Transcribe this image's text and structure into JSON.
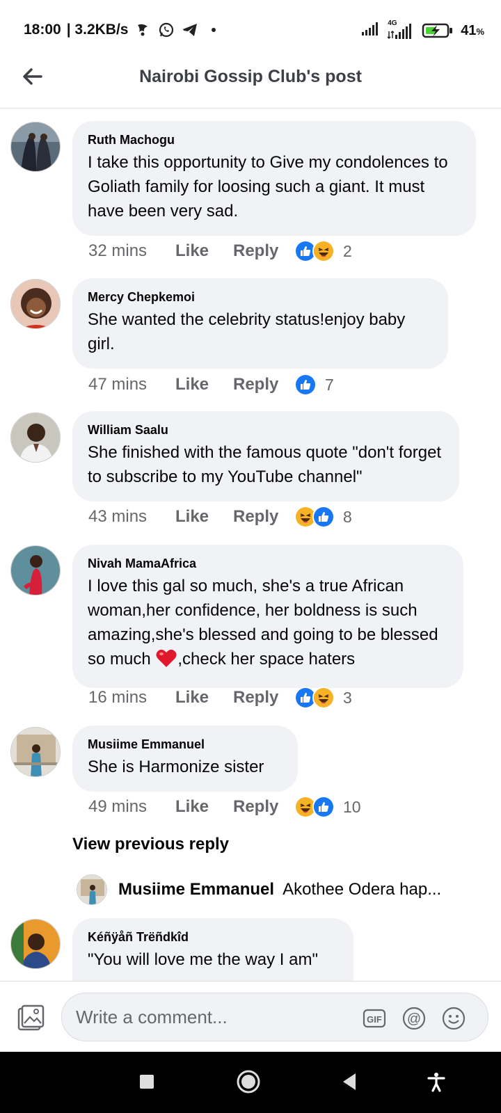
{
  "status_bar": {
    "time": "18:00",
    "speed": "| 3.2KB/s",
    "network": "4G",
    "battery": "41",
    "battery_unit": "%",
    "icons": [
      "mystery-app-icon",
      "whatsapp-icon",
      "telegram-icon",
      "dot-icon",
      "signal-icon",
      "signal-4g-icon",
      "battery-charging-icon"
    ]
  },
  "header": {
    "title": "Nairobi Gossip Club's post",
    "back_icon": "arrow-left-icon"
  },
  "comments": [
    {
      "author": "Ruth Machogu",
      "text": "I take this opportunity to Give my condolences to Goliath family for loosing such a giant. It must have been very sad.",
      "time": "32 mins",
      "like": "Like",
      "reply": "Reply",
      "reactions": [
        "like",
        "haha"
      ],
      "count": "2"
    },
    {
      "author": "Mercy Chepkemoi",
      "text": "She wanted the celebrity status!enjoy baby girl.",
      "time": "47 mins",
      "like": "Like",
      "reply": "Reply",
      "reactions": [
        "like"
      ],
      "count": "7"
    },
    {
      "author": "William Saalu",
      "text": "She finished with the famous quote \"don't forget to subscribe to my YouTube channel\"",
      "time": "43 mins",
      "like": "Like",
      "reply": "Reply",
      "reactions": [
        "haha",
        "like"
      ],
      "count": "8"
    },
    {
      "author": "Nivah MamaAfrica",
      "text_before_heart": "I love this gal so much, she's a true African woman,her confidence, her boldness is such amazing,she's blessed and going to be blessed so much ",
      "text_after_heart": ",check her space haters",
      "time": "16 mins",
      "like": "Like",
      "reply": "Reply",
      "reactions": [
        "like",
        "haha"
      ],
      "count": "3"
    },
    {
      "author": "Musiime Emmanuel",
      "text": "She is Harmonize sister",
      "time": "49 mins",
      "like": "Like",
      "reply": "Reply",
      "reactions": [
        "haha",
        "like"
      ],
      "count": "10"
    },
    {
      "author": "Kéñÿåñ Trëñdkîd",
      "text": "\"You will love me the way I am\""
    }
  ],
  "view_previous": "View previous reply",
  "reply_preview": {
    "author": "Musiime Emmanuel",
    "text": "Akothee Odera hap..."
  },
  "composer": {
    "placeholder": "Write a comment...",
    "icons": [
      "photo-icon",
      "gif-icon",
      "mention-icon",
      "emoji-icon"
    ]
  },
  "colors": {
    "bubble": "#f0f2f5",
    "like_blue": "#1877f2",
    "haha_yellow": "#f7b125",
    "meta_grey": "#65676b",
    "heart_red": "#e0182d"
  }
}
